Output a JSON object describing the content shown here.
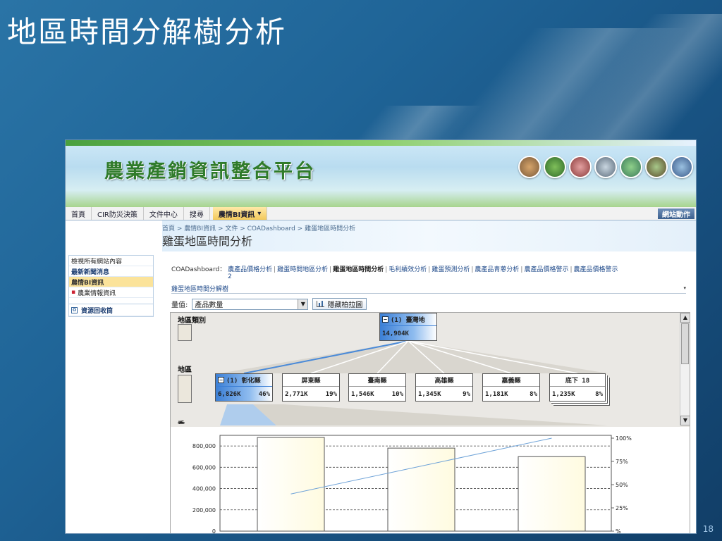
{
  "slide": {
    "title": "地區時間分解樹分析",
    "page_number": "18"
  },
  "site": {
    "logo_text": "農業產銷資訊整合平台",
    "nav": [
      "首頁",
      "CIR防災決策",
      "文件中心",
      "搜尋"
    ],
    "nav_active": "農情BI資訊",
    "nav_active_caret": "▾",
    "site_action": "網站動作",
    "breadcrumb": "首頁 > 農情BI資訊 > 文件 > COADashboard > 雞蛋地區時間分析",
    "page_title": "雞蛋地區時間分析"
  },
  "sidebar": {
    "items": [
      {
        "label": "檢視所有網站內容",
        "style": "plain"
      },
      {
        "label": "最新新聞消息",
        "style": "bold"
      },
      {
        "label": "農情BI資訊",
        "style": "selected"
      },
      {
        "label": "農業情報資訊",
        "style": "bullet"
      }
    ],
    "recycle_label": "資源回收筒"
  },
  "dashboard": {
    "label": "COADashboard：",
    "links": [
      "農產品價格分析",
      "雞蛋時間地區分析",
      "雞蛋地區時間分析",
      "毛利績效分析",
      "雞蛋預測分析",
      "農產品青蔥分析",
      "農產品價格警示",
      "農產品價格警示"
    ],
    "current_index": 2,
    "trailing_number": "2",
    "tree_header": "雞蛋地區時間分解樹",
    "tree_header_arrow": "▾"
  },
  "toolbar": {
    "measure_label": "量值:",
    "measure_value": "產品數量",
    "pareto_button": "隱藏柏拉圖"
  },
  "tree": {
    "level1_label": "地區類別",
    "level2_label": "地區",
    "level3_label": "季",
    "root": {
      "title": "(1) 臺灣地",
      "value": "14,904K"
    },
    "children": [
      {
        "title": "(1) 彰化縣",
        "value": "6,826K",
        "pct": "46%",
        "expanded": true
      },
      {
        "title": "屏東縣",
        "value": "2,771K",
        "pct": "19%"
      },
      {
        "title": "臺南縣",
        "value": "1,546K",
        "pct": "10%"
      },
      {
        "title": "高雄縣",
        "value": "1,345K",
        "pct": "9%"
      },
      {
        "title": "嘉義縣",
        "value": "1,181K",
        "pct": "8%"
      },
      {
        "title": "底下 18",
        "value": "1,235K",
        "pct": "8%",
        "stack": true
      }
    ]
  },
  "chart_data": {
    "type": "bar",
    "title": "",
    "xlabel": "",
    "ylabel": "",
    "ylim": [
      0,
      900000
    ],
    "yticks": [
      "0",
      "200,000",
      "400,000",
      "600,000",
      "800,000"
    ],
    "y2ticks": [
      "%",
      "25%",
      "50%",
      "75%",
      "100%"
    ],
    "categories": [
      "",
      "",
      ""
    ],
    "values": [
      880000,
      780000,
      700000
    ],
    "pareto_line": [
      40,
      70,
      100
    ],
    "grid": true,
    "colors": {
      "bar": "#fffbe0",
      "bar_edge": "#555555",
      "line": "#6fa3d8"
    }
  }
}
